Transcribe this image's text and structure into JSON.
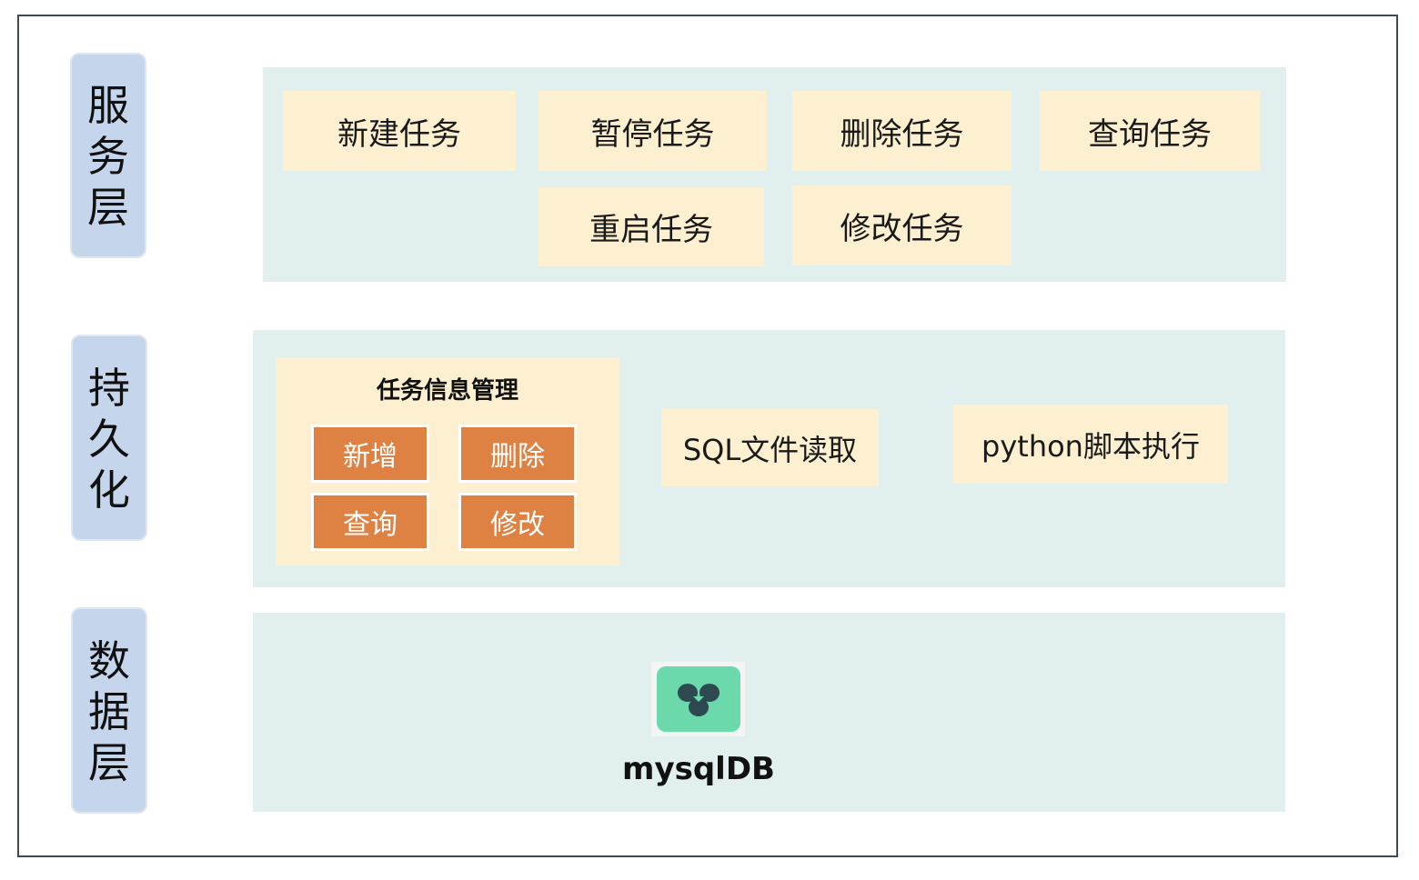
{
  "layers": {
    "service": {
      "label": "服\n务\n层",
      "tasks": [
        "新建任务",
        "暂停任务",
        "删除任务",
        "查询任务",
        "重启任务",
        "修改任务"
      ]
    },
    "persistence": {
      "label": "持\n久\n化",
      "group_title": "任务信息管理",
      "operations": [
        "新增",
        "删除",
        "查询",
        "修改"
      ],
      "sql_file": "SQL文件读取",
      "python_exec": "python脚本执行"
    },
    "data": {
      "label": "数\n据\n层",
      "db_name": "mysqlDB",
      "db_icon": "database-icon"
    }
  },
  "colors": {
    "layer_label_bg": "#c5d6ec",
    "panel_bg": "#e1f0ef",
    "box_bg": "#fcf0d1",
    "operation_bg": "#de8244",
    "db_icon_bg": "#6bd9ab",
    "db_icon_fg": "#2e4950"
  }
}
